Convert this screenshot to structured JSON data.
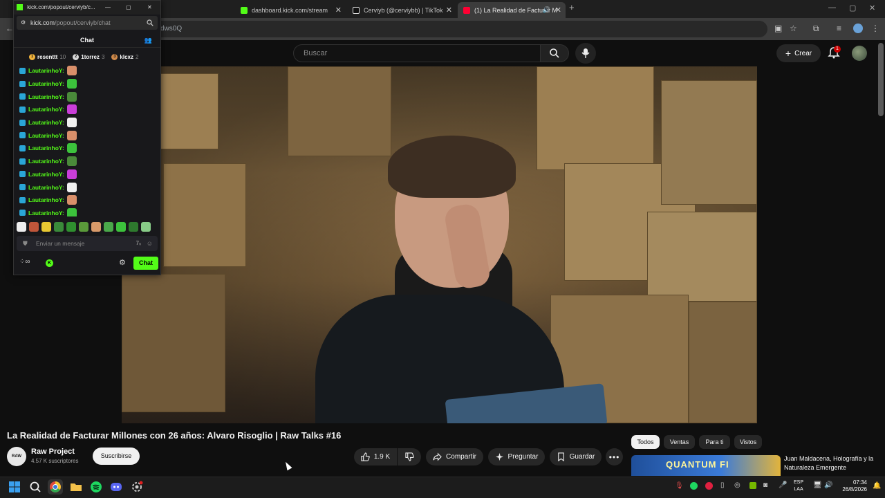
{
  "browser": {
    "tabs": [
      {
        "title": "dashboard.kick.com/stream",
        "icon": "kick-icon",
        "active": false
      },
      {
        "title": "Cerviyb (@cerviybb) | TikTok",
        "icon": "tiktok-icon",
        "active": false
      },
      {
        "title": "(1) La Realidad de Facturar M",
        "icon": "youtube-icon",
        "active": true
      }
    ],
    "url_fragment": "dws0Q"
  },
  "youtube": {
    "search_placeholder": "Buscar",
    "create_label": "Crear",
    "notification_count": "1",
    "video_title": "La Realidad de Facturar Millones con 26 años: Alvaro Risoglio | Raw Talks #16",
    "channel": {
      "avatar_text": "RAW",
      "name": "Raw Project",
      "subscribers": "4.57 K suscriptores",
      "subscribe_label": "Suscribirse"
    },
    "actions": {
      "likes": "1.9 K",
      "share": "Compartir",
      "ask": "Preguntar",
      "save": "Guardar"
    },
    "chips": [
      "Todos",
      "Ventas",
      "Para ti",
      "Vistos"
    ],
    "recommendation": {
      "thumb_text": "QUANTUM FI",
      "title": "Juan Maldacena, Holografía y la Naturaleza Emergente"
    }
  },
  "kick": {
    "window_title": "kick.com/popout/cerviyb/c...",
    "url_host": "kick.com",
    "url_path": "/popout/cerviyb/chat",
    "chat_header": "Chat",
    "leaders": [
      {
        "name": "resenttt",
        "count": "10",
        "color": "#f2b43c"
      },
      {
        "name": "1torrez",
        "count": "3",
        "color": "#d9d9d9"
      },
      {
        "name": "klcxz",
        "count": "2",
        "color": "#d08a4a"
      }
    ],
    "messages": [
      {
        "user": "LautarinhoY:",
        "emote_color": "#d98f6a"
      },
      {
        "user": "LautarinhoY:",
        "emote_color": "#3cc23c"
      },
      {
        "user": "LautarinhoY:",
        "emote_color": "#4a8a3a"
      },
      {
        "user": "LautarinhoY:",
        "emote_color": "#c93ed8"
      },
      {
        "user": "LautarinhoY:",
        "emote_color": "#f0f0f0"
      },
      {
        "user": "LautarinhoY:",
        "emote_color": "#d98f6a"
      },
      {
        "user": "LautarinhoY:",
        "emote_color": "#3cc23c"
      },
      {
        "user": "LautarinhoY:",
        "emote_color": "#4a8a3a"
      },
      {
        "user": "LautarinhoY:",
        "emote_color": "#c93ed8"
      },
      {
        "user": "LautarinhoY:",
        "emote_color": "#f0f0f0"
      },
      {
        "user": "LautarinhoY:",
        "emote_color": "#d98f6a"
      },
      {
        "user": "LautarinhoY:",
        "emote_color": "#3cc23c"
      }
    ],
    "emote_bar_colors": [
      "#eeeeee",
      "#c0563a",
      "#e8c832",
      "#3a8a3a",
      "#2f8f2f",
      "#5a9a3a",
      "#d89a6a",
      "#4aa84a",
      "#3cc23c",
      "#2e7a2e",
      "#88cc88"
    ],
    "input_placeholder": "Enviar un mensaje",
    "send_label": "Chat",
    "accent": "#53fc18"
  },
  "taskbar": {
    "lang": "ESP",
    "lang_sub": "LAA",
    "time": "07:34",
    "date": "26/8/2026"
  }
}
